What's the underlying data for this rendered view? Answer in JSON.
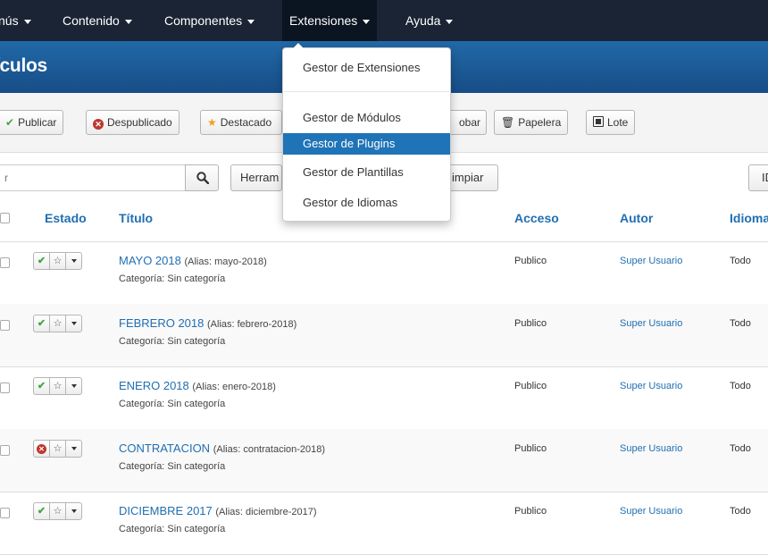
{
  "navbar": {
    "items": [
      {
        "label": "nús"
      },
      {
        "label": "Contenido"
      },
      {
        "label": "Componentes"
      },
      {
        "label": "Extensiones"
      },
      {
        "label": "Ayuda"
      }
    ]
  },
  "page_title": "ículos",
  "toolbar": {
    "buttons": [
      {
        "label": "Publicar",
        "icon": "check-icon"
      },
      {
        "label": "Despublicado",
        "icon": "x-circle-icon"
      },
      {
        "label": "Destacado",
        "icon": "star-icon"
      },
      {
        "label": "obar",
        "icon": ""
      },
      {
        "label": "Papelera",
        "icon": "trash-icon"
      },
      {
        "label": "Lote",
        "icon": "batch-icon"
      }
    ]
  },
  "filters": {
    "search_placeholder": "r",
    "tools_label": "Herram",
    "clear_label": "impiar",
    "id_label": "ID"
  },
  "table": {
    "headers": {
      "status": "Estado",
      "title": "Título",
      "access": "Acceso",
      "author": "Autor",
      "language": "Idioma"
    },
    "rows": [
      {
        "title": "MAYO 2018",
        "alias": "(Alias: mayo-2018)",
        "category": "Categoría: Sin categoría",
        "access": "Publico",
        "author": "Super Usuario",
        "language": "Todo",
        "published": true
      },
      {
        "title": "FEBRERO 2018",
        "alias": "(Alias: febrero-2018)",
        "category": "Categoría: Sin categoría",
        "access": "Publico",
        "author": "Super Usuario",
        "language": "Todo",
        "published": true
      },
      {
        "title": "ENERO 2018",
        "alias": "(Alias: enero-2018)",
        "category": "Categoría: Sin categoría",
        "access": "Publico",
        "author": "Super Usuario",
        "language": "Todo",
        "published": true
      },
      {
        "title": "CONTRATACION",
        "alias": "(Alias: contratacion-2018)",
        "category": "Categoría: Sin categoría",
        "access": "Publico",
        "author": "Super Usuario",
        "language": "Todo",
        "published": false
      },
      {
        "title": "DICIEMBRE 2017",
        "alias": "(Alias: diciembre-2017)",
        "category": "Categoría: Sin categoría",
        "access": "Publico",
        "author": "Super Usuario",
        "language": "Todo",
        "published": true
      }
    ]
  },
  "extensions_menu": {
    "items": [
      {
        "label": "Gestor de Extensiones"
      },
      {
        "label": "Gestor de Módulos"
      },
      {
        "label": "Gestor de Plugins"
      },
      {
        "label": "Gestor de Plantillas"
      },
      {
        "label": "Gestor de Idiomas"
      }
    ],
    "active_index": 2
  },
  "colors": {
    "navbar": "#1a2434",
    "header": "#1c5b9a",
    "link": "#1f6fb2",
    "highlight": "#1f73b7",
    "success": "#46a546",
    "danger": "#bd362f"
  }
}
